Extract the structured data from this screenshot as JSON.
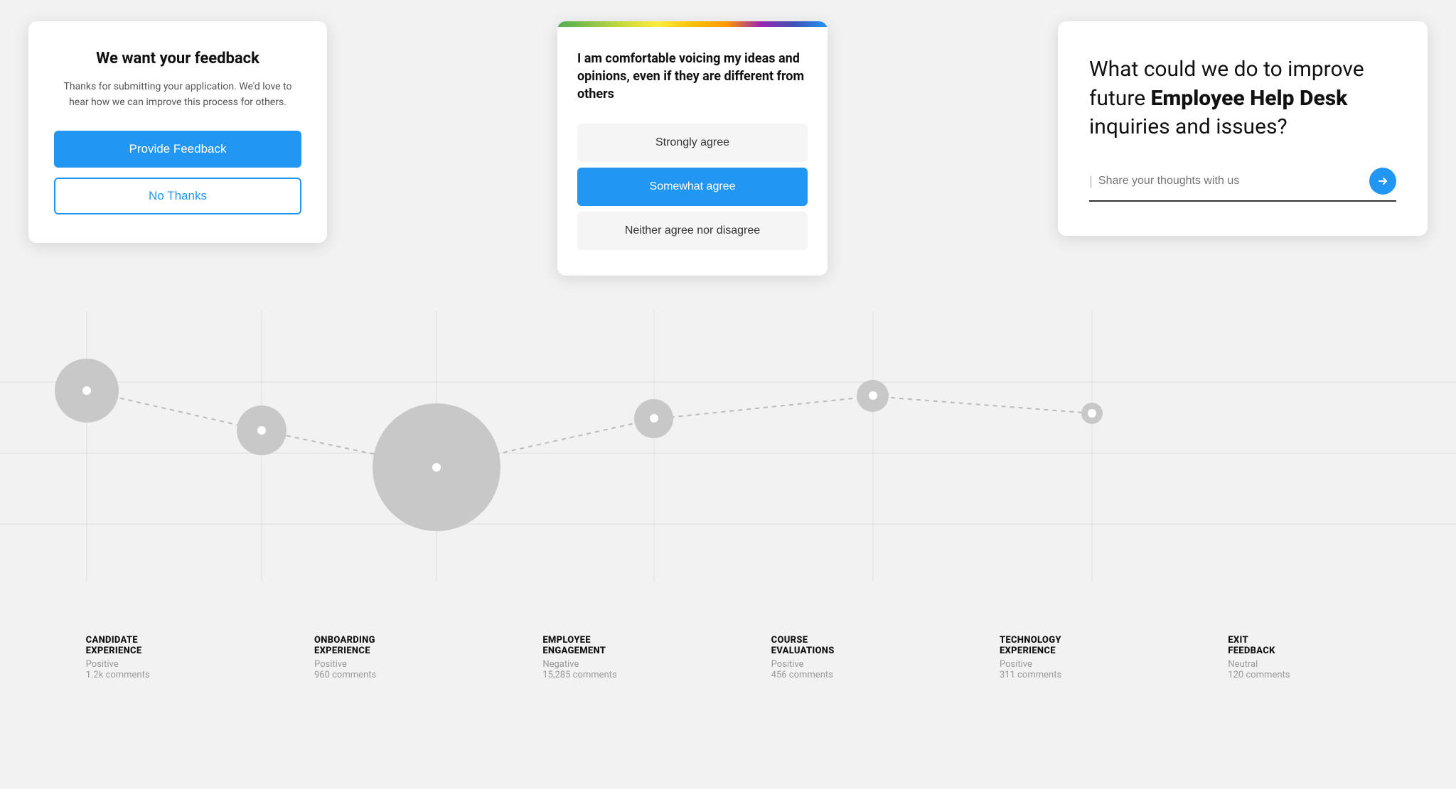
{
  "cards": {
    "feedback": {
      "title": "We want your feedback",
      "description": "Thanks for submitting your application. We'd love to hear how we can improve this process for others.",
      "provide_btn": "Provide Feedback",
      "no_thanks_btn": "No Thanks"
    },
    "survey": {
      "gradient": true,
      "question": "I am comfortable voicing my ideas and opinions, even if they are different from others",
      "options": [
        {
          "label": "Strongly agree",
          "selected": false
        },
        {
          "label": "Somewhat agree",
          "selected": true
        },
        {
          "label": "Neither agree nor disagree",
          "selected": false
        }
      ]
    },
    "open_feedback": {
      "heading_normal": "What could we do to improve future ",
      "heading_bold": "Employee Help Desk",
      "heading_end": " inquiries and issues?",
      "input_placeholder": "Share your thoughts with us"
    }
  },
  "chart": {
    "categories": [
      {
        "id": "candidate",
        "title": "CANDIDATE\nEXPERIENCE",
        "sentiment": "Positive",
        "comments": "1.2k comments",
        "bubble_size": 90,
        "x_pct": 6,
        "y_pct": 28
      },
      {
        "id": "onboarding",
        "title": "ONBOARDING\nEXPERIENCE",
        "sentiment": "Positive",
        "comments": "960 comments",
        "bubble_size": 70,
        "x_pct": 18,
        "y_pct": 42
      },
      {
        "id": "employee",
        "title": "EMPLOYEE\nENGAGEMENT",
        "sentiment": "Negative",
        "comments": "15,285 comments",
        "bubble_size": 180,
        "x_pct": 30,
        "y_pct": 55
      },
      {
        "id": "course",
        "title": "COURSE\nEVALUATIONS",
        "sentiment": "Positive",
        "comments": "456 comments",
        "bubble_size": 55,
        "x_pct": 45,
        "y_pct": 38
      },
      {
        "id": "technology",
        "title": "TECHNOLOGY\nEXPERIENCE",
        "sentiment": "Positive",
        "comments": "311 comments",
        "bubble_size": 45,
        "x_pct": 60,
        "y_pct": 30
      },
      {
        "id": "exit",
        "title": "EXIT\nFEEDBACK",
        "sentiment": "Neutral",
        "comments": "120 comments",
        "bubble_size": 30,
        "x_pct": 75,
        "y_pct": 36
      }
    ]
  }
}
